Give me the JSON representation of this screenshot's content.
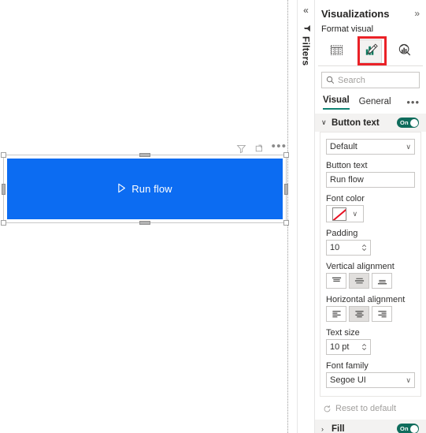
{
  "canvas": {
    "visual_header": {
      "filter_icon": "filter-icon",
      "focus_icon": "focus-mode-icon",
      "more_label": "•••"
    },
    "button_visual": {
      "label": "Run flow",
      "icon": "play-icon",
      "fill_color": "#0C6CF2",
      "text_color": "#FFFFFF",
      "selected": true
    }
  },
  "filters_rail": {
    "collapse_label": "«",
    "filter_icon": "filter-icon",
    "label": "Filters"
  },
  "viz_pane": {
    "title": "Visualizations",
    "expand_label": "»",
    "format_visual_label": "Format visual",
    "format_tabs": [
      {
        "name": "fields-tab",
        "icon": "fields-table-icon",
        "selected": false
      },
      {
        "name": "format-tab",
        "icon": "format-paintbrush-icon",
        "selected": true
      },
      {
        "name": "analytics-tab",
        "icon": "analytics-magnifier-icon",
        "selected": false
      }
    ],
    "highlight_color": "#EA2127",
    "search": {
      "placeholder": "Search",
      "value": "",
      "icon": "search-icon"
    },
    "tabs": [
      {
        "label": "Visual",
        "active": true
      },
      {
        "label": "General",
        "active": false
      }
    ],
    "tabs_more_label": "•••",
    "accent_color": "#118273"
  },
  "cards": {
    "button_text": {
      "title": "Button text",
      "chevron": "∨",
      "expanded": true,
      "toggle": {
        "state_label": "On",
        "on": true,
        "color": "#0F6C5C"
      },
      "state_dropdown": {
        "value": "Default",
        "caret": "∨"
      },
      "button_text_field": {
        "label": "Button text",
        "value": "Run flow"
      },
      "font_color": {
        "label": "Font color",
        "value": "none",
        "caret": "∨"
      },
      "padding": {
        "label": "Padding",
        "value": "10"
      },
      "vertical_alignment": {
        "label": "Vertical alignment",
        "options": [
          "top",
          "middle",
          "bottom"
        ],
        "selected": "middle"
      },
      "horizontal_alignment": {
        "label": "Horizontal alignment",
        "options": [
          "left",
          "center",
          "right"
        ],
        "selected": "center"
      },
      "text_size": {
        "label": "Text size",
        "value": "10 pt"
      },
      "font_family": {
        "label": "Font family",
        "value": "Segoe UI",
        "caret": "∨"
      }
    },
    "reset_to_default": {
      "label": "Reset to default",
      "icon": "reset-icon"
    },
    "fill": {
      "title": "Fill",
      "chevron": "›",
      "expanded": false,
      "toggle": {
        "state_label": "On",
        "on": true,
        "color": "#0F6C5C"
      }
    }
  }
}
